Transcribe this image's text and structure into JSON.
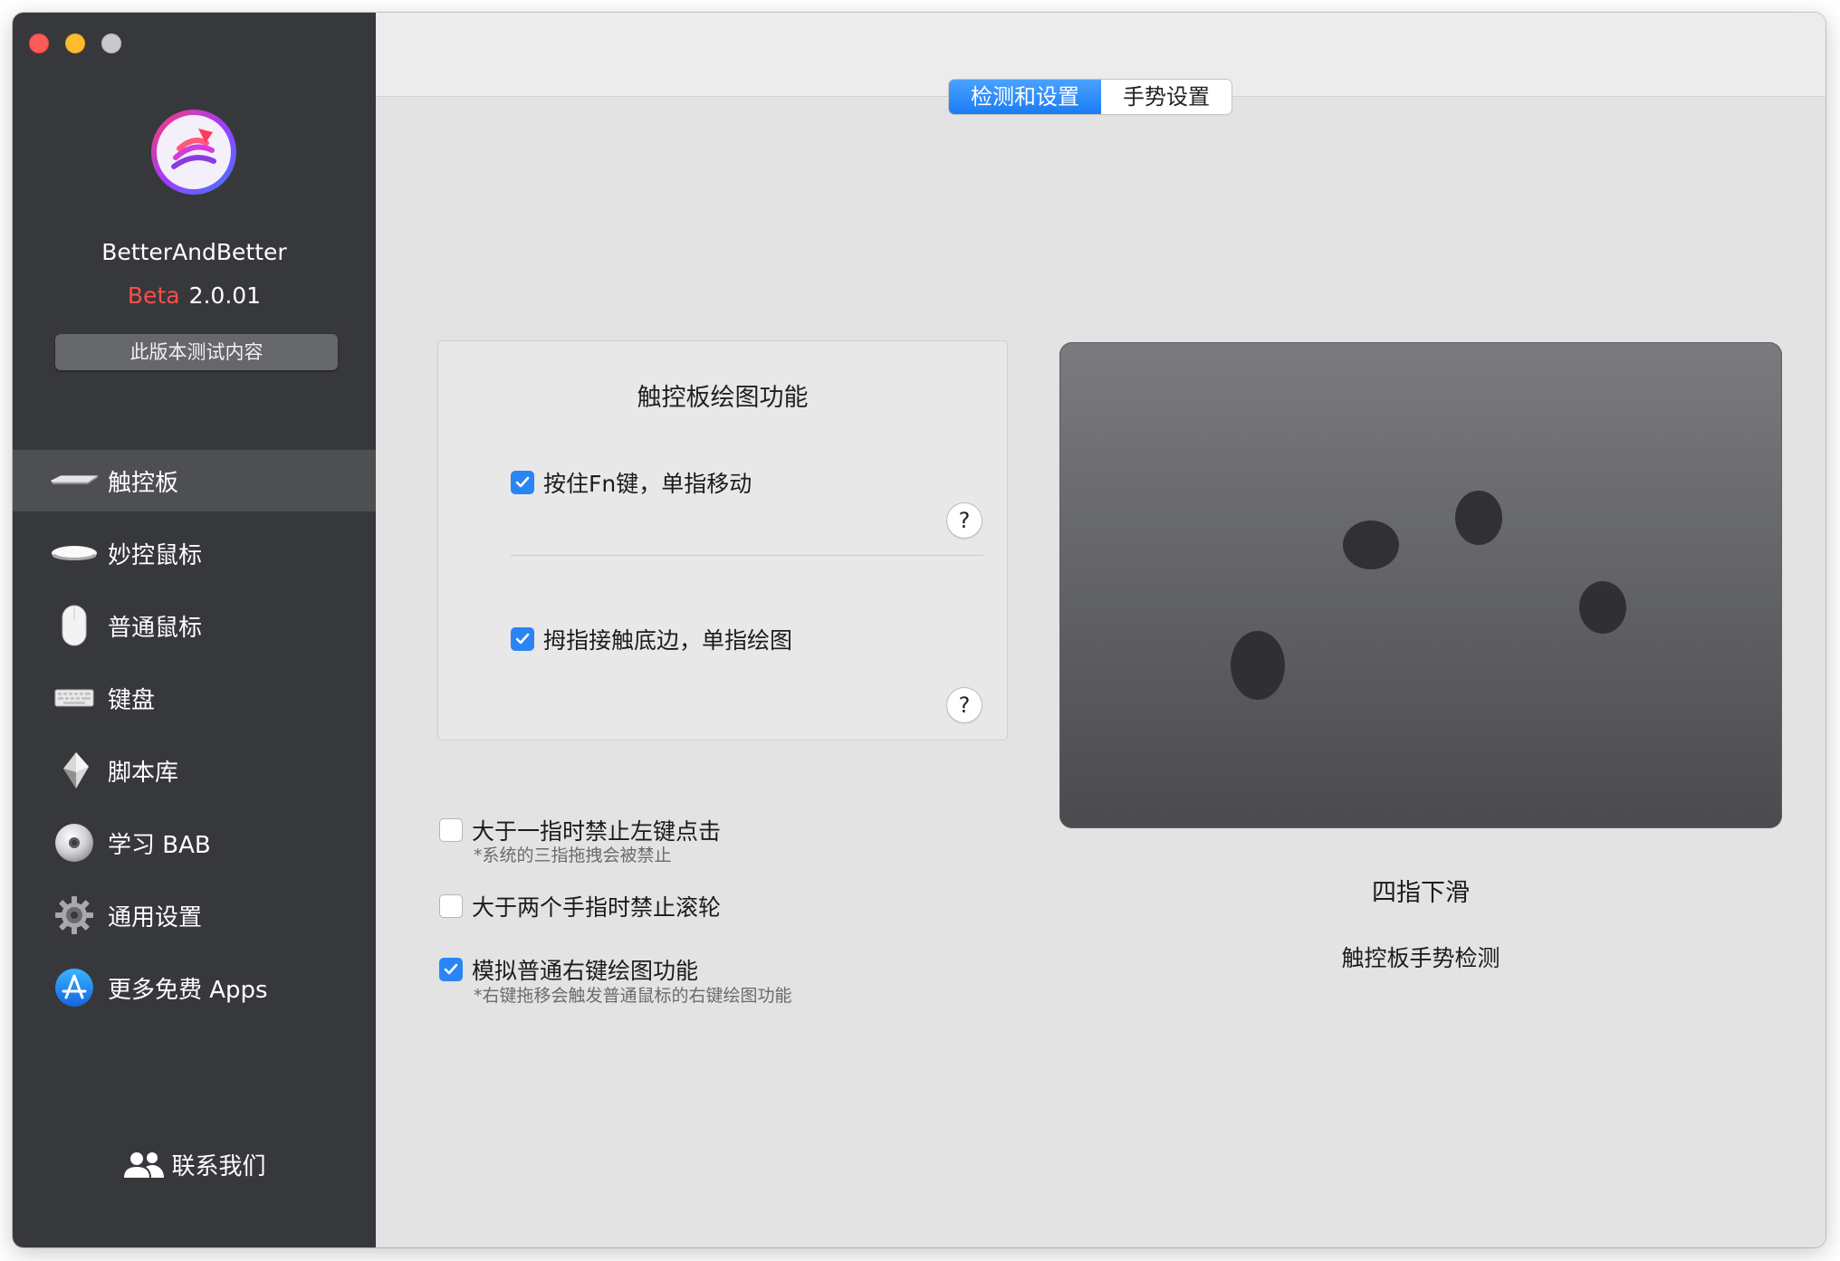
{
  "app": {
    "name": "BetterAndBetter",
    "beta_label": "Beta",
    "version": "2.0.01",
    "test_button": "此版本测试内容"
  },
  "sidebar": {
    "items": [
      {
        "label": "触控板",
        "icon": "trackpad-icon",
        "active": true
      },
      {
        "label": "妙控鼠标",
        "icon": "magic-mouse-icon"
      },
      {
        "label": "普通鼠标",
        "icon": "mouse-icon"
      },
      {
        "label": "键盘",
        "icon": "keyboard-icon"
      },
      {
        "label": "脚本库",
        "icon": "script-icon"
      },
      {
        "label": "学习 BAB",
        "icon": "disc-icon"
      },
      {
        "label": "通用设置",
        "icon": "gear-icon"
      },
      {
        "label": "更多免费 Apps",
        "icon": "app-store-icon"
      }
    ],
    "contact": "联系我们"
  },
  "tabs": [
    {
      "label": "检测和设置",
      "active": true
    },
    {
      "label": "手势设置"
    }
  ],
  "panel": {
    "title": "触控板绘图功能",
    "option1": {
      "label": "按住Fn键，单指移动",
      "checked": true
    },
    "option2": {
      "label": "拇指接触底边，单指绘图",
      "checked": true
    },
    "help": "?"
  },
  "options": {
    "disable_left_click": {
      "label": "大于一指时禁止左键点击",
      "note": "*系统的三指拖拽会被禁止",
      "checked": false
    },
    "disable_scroll": {
      "label": "大于两个手指时禁止滚轮",
      "checked": false
    },
    "right_draw": {
      "label": "模拟普通右键绘图功能",
      "note": "*右键拖移会触发普通鼠标的右键绘图功能",
      "checked": true
    }
  },
  "gesture": {
    "name": "四指下滑",
    "subtitle": "触控板手势检测"
  },
  "colors": {
    "accent": "#2a84f6",
    "sidebar_bg": "#37383c",
    "beta_red": "#ff4d4a"
  }
}
